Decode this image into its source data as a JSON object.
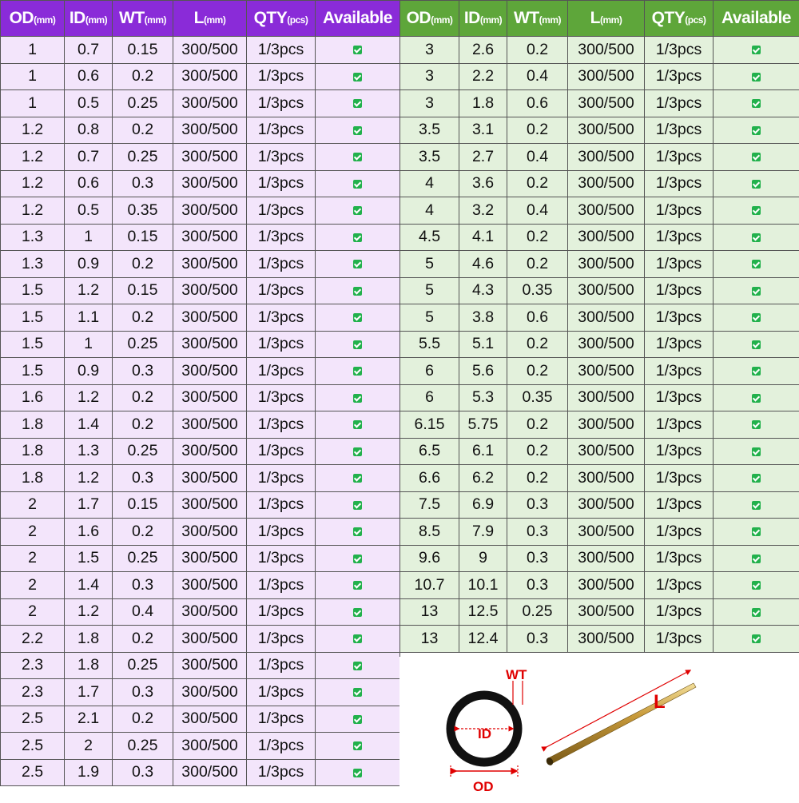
{
  "headers": [
    {
      "main": "OD",
      "unit": "(mm)"
    },
    {
      "main": "ID",
      "unit": "(mm)"
    },
    {
      "main": "WT",
      "unit": "(mm)"
    },
    {
      "main": "L",
      "unit": "(mm)"
    },
    {
      "main": "QTY",
      "unit": "(pcs)"
    },
    {
      "main": "Available",
      "unit": ""
    }
  ],
  "colors": {
    "left_header": "#8a2bd8",
    "left_row": "#f3e5fb",
    "right_header": "#5ea63a",
    "right_row": "#e3f1dc",
    "check": "#22b14c",
    "label_red": "#e00000"
  },
  "left_rows": [
    [
      "1",
      "0.7",
      "0.15",
      "300/500",
      "1/3pcs"
    ],
    [
      "1",
      "0.6",
      "0.2",
      "300/500",
      "1/3pcs"
    ],
    [
      "1",
      "0.5",
      "0.25",
      "300/500",
      "1/3pcs"
    ],
    [
      "1.2",
      "0.8",
      "0.2",
      "300/500",
      "1/3pcs"
    ],
    [
      "1.2",
      "0.7",
      "0.25",
      "300/500",
      "1/3pcs"
    ],
    [
      "1.2",
      "0.6",
      "0.3",
      "300/500",
      "1/3pcs"
    ],
    [
      "1.2",
      "0.5",
      "0.35",
      "300/500",
      "1/3pcs"
    ],
    [
      "1.3",
      "1",
      "0.15",
      "300/500",
      "1/3pcs"
    ],
    [
      "1.3",
      "0.9",
      "0.2",
      "300/500",
      "1/3pcs"
    ],
    [
      "1.5",
      "1.2",
      "0.15",
      "300/500",
      "1/3pcs"
    ],
    [
      "1.5",
      "1.1",
      "0.2",
      "300/500",
      "1/3pcs"
    ],
    [
      "1.5",
      "1",
      "0.25",
      "300/500",
      "1/3pcs"
    ],
    [
      "1.5",
      "0.9",
      "0.3",
      "300/500",
      "1/3pcs"
    ],
    [
      "1.6",
      "1.2",
      "0.2",
      "300/500",
      "1/3pcs"
    ],
    [
      "1.8",
      "1.4",
      "0.2",
      "300/500",
      "1/3pcs"
    ],
    [
      "1.8",
      "1.3",
      "0.25",
      "300/500",
      "1/3pcs"
    ],
    [
      "1.8",
      "1.2",
      "0.3",
      "300/500",
      "1/3pcs"
    ],
    [
      "2",
      "1.7",
      "0.15",
      "300/500",
      "1/3pcs"
    ],
    [
      "2",
      "1.6",
      "0.2",
      "300/500",
      "1/3pcs"
    ],
    [
      "2",
      "1.5",
      "0.25",
      "300/500",
      "1/3pcs"
    ],
    [
      "2",
      "1.4",
      "0.3",
      "300/500",
      "1/3pcs"
    ],
    [
      "2",
      "1.2",
      "0.4",
      "300/500",
      "1/3pcs"
    ],
    [
      "2.2",
      "1.8",
      "0.2",
      "300/500",
      "1/3pcs"
    ],
    [
      "2.3",
      "1.8",
      "0.25",
      "300/500",
      "1/3pcs"
    ],
    [
      "2.3",
      "1.7",
      "0.3",
      "300/500",
      "1/3pcs"
    ],
    [
      "2.5",
      "2.1",
      "0.2",
      "300/500",
      "1/3pcs"
    ],
    [
      "2.5",
      "2",
      "0.25",
      "300/500",
      "1/3pcs"
    ],
    [
      "2.5",
      "1.9",
      "0.3",
      "300/500",
      "1/3pcs"
    ]
  ],
  "right_rows": [
    [
      "3",
      "2.6",
      "0.2",
      "300/500",
      "1/3pcs"
    ],
    [
      "3",
      "2.2",
      "0.4",
      "300/500",
      "1/3pcs"
    ],
    [
      "3",
      "1.8",
      "0.6",
      "300/500",
      "1/3pcs"
    ],
    [
      "3.5",
      "3.1",
      "0.2",
      "300/500",
      "1/3pcs"
    ],
    [
      "3.5",
      "2.7",
      "0.4",
      "300/500",
      "1/3pcs"
    ],
    [
      "4",
      "3.6",
      "0.2",
      "300/500",
      "1/3pcs"
    ],
    [
      "4",
      "3.2",
      "0.4",
      "300/500",
      "1/3pcs"
    ],
    [
      "4.5",
      "4.1",
      "0.2",
      "300/500",
      "1/3pcs"
    ],
    [
      "5",
      "4.6",
      "0.2",
      "300/500",
      "1/3pcs"
    ],
    [
      "5",
      "4.3",
      "0.35",
      "300/500",
      "1/3pcs"
    ],
    [
      "5",
      "3.8",
      "0.6",
      "300/500",
      "1/3pcs"
    ],
    [
      "5.5",
      "5.1",
      "0.2",
      "300/500",
      "1/3pcs"
    ],
    [
      "6",
      "5.6",
      "0.2",
      "300/500",
      "1/3pcs"
    ],
    [
      "6",
      "5.3",
      "0.35",
      "300/500",
      "1/3pcs"
    ],
    [
      "6.15",
      "5.75",
      "0.2",
      "300/500",
      "1/3pcs"
    ],
    [
      "6.5",
      "6.1",
      "0.2",
      "300/500",
      "1/3pcs"
    ],
    [
      "6.6",
      "6.2",
      "0.2",
      "300/500",
      "1/3pcs"
    ],
    [
      "7.5",
      "6.9",
      "0.3",
      "300/500",
      "1/3pcs"
    ],
    [
      "8.5",
      "7.9",
      "0.3",
      "300/500",
      "1/3pcs"
    ],
    [
      "9.6",
      "9",
      "0.3",
      "300/500",
      "1/3pcs"
    ],
    [
      "10.7",
      "10.1",
      "0.3",
      "300/500",
      "1/3pcs"
    ],
    [
      "13",
      "12.5",
      "0.25",
      "300/500",
      "1/3pcs"
    ],
    [
      "13",
      "12.4",
      "0.3",
      "300/500",
      "1/3pcs"
    ]
  ],
  "diagram": {
    "wt_label": "WT",
    "id_label": "ID",
    "od_label": "OD",
    "length_label": "L",
    "tube_icon": "brass-tube-icon",
    "ring_icon": "tube-cross-section-icon"
  }
}
